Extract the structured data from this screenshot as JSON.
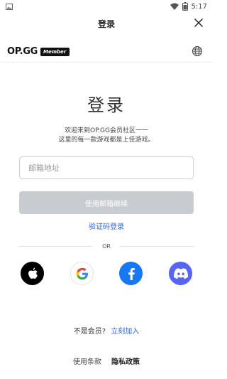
{
  "status_bar": {
    "time": "5:17",
    "icons": [
      "image-icon",
      "wifi-icon",
      "battery-icon"
    ]
  },
  "top_bar": {
    "title": "登录",
    "close_icon": "close-icon"
  },
  "brand": {
    "logo_text": "OP.GG",
    "member_label": "Member",
    "globe_icon": "globe-icon"
  },
  "main": {
    "heading": "登录",
    "welcome_line1": "欢迎来到OP.GG会员社区一一",
    "welcome_line2": "这里的每一款游戏都是上佳游戏。"
  },
  "email_field": {
    "placeholder": "邮箱地址",
    "value": ""
  },
  "continue_button": {
    "label": "使用邮箱继续"
  },
  "code_login_link": {
    "label": "验证码登录"
  },
  "divider": {
    "label": "OR"
  },
  "social_buttons": [
    {
      "name": "apple",
      "icon": "apple-icon"
    },
    {
      "name": "google",
      "icon": "google-icon"
    },
    {
      "name": "facebook",
      "icon": "facebook-icon"
    },
    {
      "name": "discord",
      "icon": "discord-icon"
    }
  ],
  "signup": {
    "prompt": "不是会员?",
    "link": "立刻加入"
  },
  "footer": {
    "terms": "使用条款",
    "privacy": "隐私政策"
  },
  "colors": {
    "link": "#2f63d6",
    "button_disabled": "#c8ccd1",
    "facebook": "#1877f2",
    "discord": "#5865f2"
  }
}
